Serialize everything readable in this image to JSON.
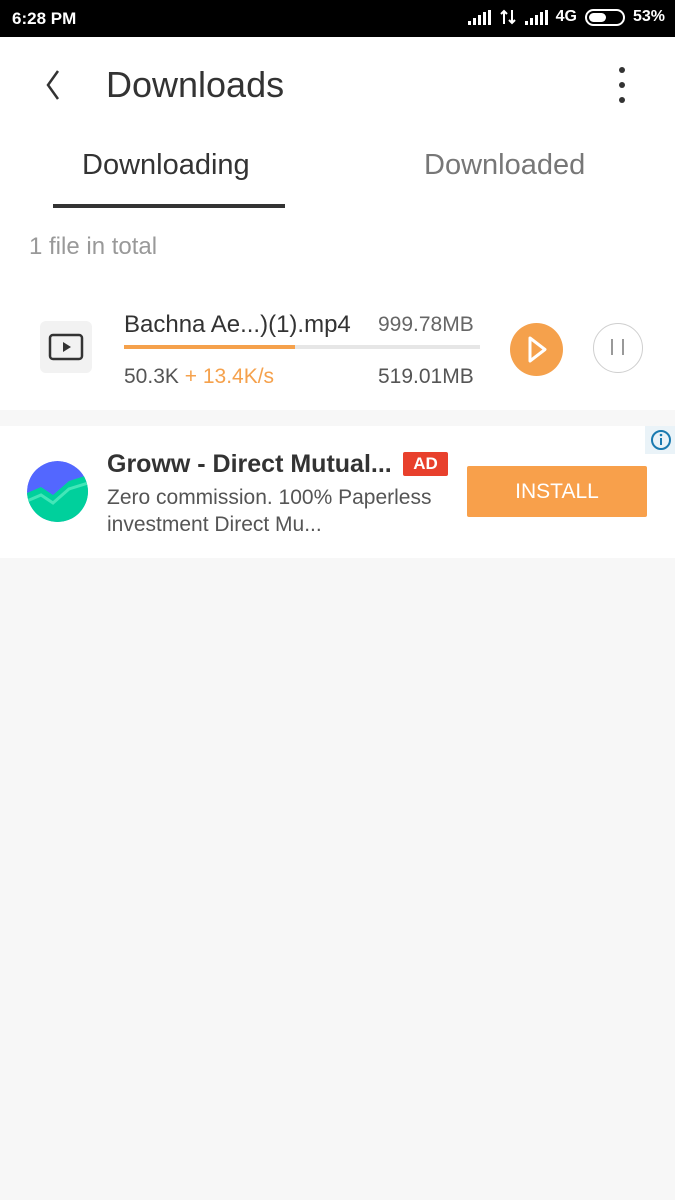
{
  "status_bar": {
    "time": "6:28 PM",
    "network": "4G",
    "battery": "53%",
    "battery_level": 0.53
  },
  "header": {
    "title": "Downloads",
    "back_icon": "chevron-left-icon",
    "menu_icon": "more-vertical-icon"
  },
  "tabs": [
    {
      "label": "Downloading",
      "active": true
    },
    {
      "label": "Downloaded",
      "active": false
    }
  ],
  "summary": "1 file in total",
  "downloads": [
    {
      "name": "Bachna Ae...)(1).mp4",
      "size": "999.78MB",
      "downloaded": "50.3K",
      "speed": "+ 13.4K/s",
      "remaining": "519.01MB",
      "progress": 0.48,
      "buffered": 0.37,
      "file_icon": "video-file-icon"
    }
  ],
  "ad": {
    "title": "Groww - Direct Mutual...",
    "badge": "AD",
    "description": "Zero commission. 100% Paperless investment Direct Mu...",
    "cta": "INSTALL",
    "info_icon": "info-icon"
  },
  "colors": {
    "accent": "#f5a14c",
    "ad_badge": "#e8402c",
    "install": "#f8a04b",
    "text": "#333333"
  }
}
